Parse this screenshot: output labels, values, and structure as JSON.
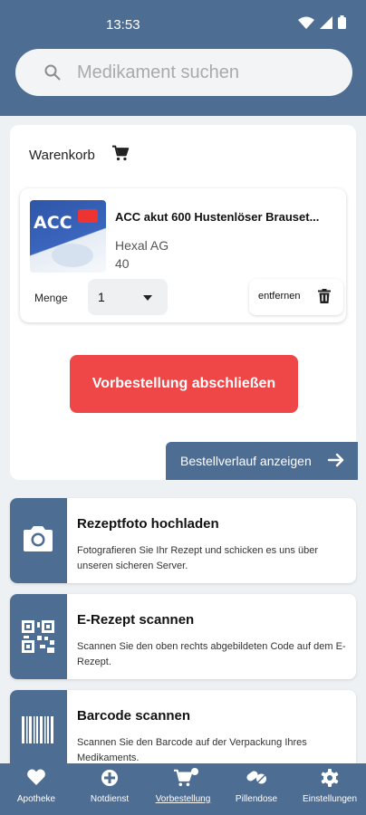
{
  "status_bar": {
    "time": "13:53"
  },
  "search": {
    "placeholder": "Medikament suchen"
  },
  "cart": {
    "title": "Warenkorb",
    "item": {
      "name": "ACC akut 600 Hustenlöser Brauset...",
      "manufacturer": "Hexal AG",
      "quantity_info": "40",
      "image_logo": "ACC",
      "quantity_label": "Menge",
      "quantity_value": "1",
      "remove_label": "entfernen"
    },
    "order_button": "Vorbestellung abschließen",
    "history_button": "Bestellverlauf anzeigen"
  },
  "features": [
    {
      "title": "Rezeptfoto hochladen",
      "description": "Fotografieren Sie Ihr Rezept und schicken es uns über unseren sicheren Server.",
      "icon": "camera-icon"
    },
    {
      "title": "E-Rezept scannen",
      "description": "Scannen Sie den oben rechts abgebildeten Code auf dem E-Rezept.",
      "icon": "qr-code-icon"
    },
    {
      "title": "Barcode scannen",
      "description": "Scannen Sie den Barcode auf der Verpackung Ihres Medikaments.",
      "icon": "barcode-icon"
    }
  ],
  "bottom_nav": [
    {
      "label": "Apotheke",
      "icon": "heart-icon"
    },
    {
      "label": "Notdienst",
      "icon": "emergency-icon"
    },
    {
      "label": "Vorbestellung",
      "icon": "cart-icon",
      "active": true
    },
    {
      "label": "Pillendose",
      "icon": "pills-icon"
    },
    {
      "label": "Einstellungen",
      "icon": "gear-icon"
    }
  ],
  "colors": {
    "primary": "#4e6d93",
    "accent_red": "#ef4747",
    "background": "#eef1f4"
  }
}
